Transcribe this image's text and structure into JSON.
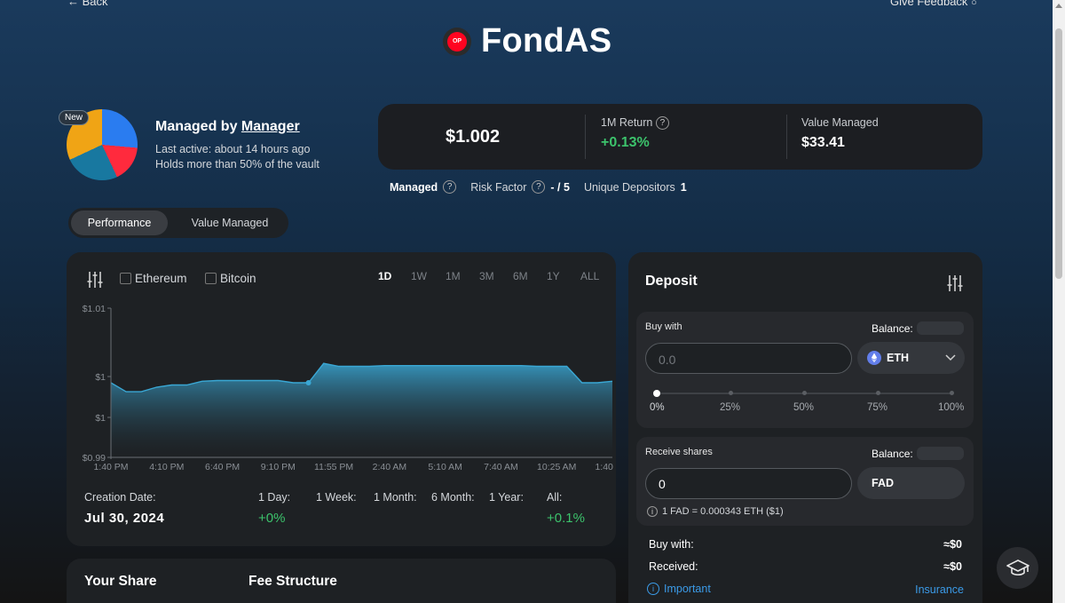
{
  "nav": {
    "back_label": "Back",
    "feedback_label": "Give Feedback"
  },
  "header": {
    "title": "FondAS",
    "badge_text": "OP"
  },
  "manager": {
    "new_badge": "New",
    "managed_by_prefix": "Managed by ",
    "manager_link": "Manager",
    "last_active": "Last active: about 14 hours ago",
    "holdings": "Holds more than 50% of the vault"
  },
  "stats": {
    "price": "$1.002",
    "return_label": "1M Return",
    "return_value": "+0.13%",
    "value_managed_label": "Value Managed",
    "value_managed": "$33.41"
  },
  "meta": {
    "managed_label": "Managed",
    "risk_label": "Risk Factor",
    "risk_value": "- / 5",
    "depositors_label": "Unique Depositors",
    "depositors_value": "1"
  },
  "tabs": [
    {
      "label": "Performance",
      "active": true
    },
    {
      "label": "Value Managed",
      "active": false
    }
  ],
  "chart_panel": {
    "compare": [
      "Ethereum",
      "Bitcoin"
    ],
    "ranges": [
      "1D",
      "1W",
      "1M",
      "3M",
      "6M",
      "1Y",
      "ALL"
    ],
    "active_range": "1D"
  },
  "chart_data": {
    "type": "area",
    "title": "",
    "xlabel": "",
    "ylabel": "",
    "y_tick_labels": [
      "$1.01",
      "$1",
      "$1",
      "$0.99"
    ],
    "x_tick_labels": [
      "1:40 PM",
      "4:10 PM",
      "6:40 PM",
      "9:10 PM",
      "11:55 PM",
      "2:40 AM",
      "5:10 AM",
      "7:40 AM",
      "10:25 AM",
      "1:40 PM"
    ],
    "ylim": [
      0.99,
      1.01
    ],
    "series": [
      {
        "values": [
          1.0,
          0.9988,
          0.9988,
          0.9994,
          0.9997,
          0.9997,
          1.0002,
          1.0003,
          1.0003,
          1.0003,
          1.0003,
          1.0003,
          1.0,
          1.0,
          1.0026,
          1.0022,
          1.0022,
          1.0022,
          1.0023,
          1.0023,
          1.0023,
          1.0023,
          1.0023,
          1.0023,
          1.0023,
          1.0023,
          1.0023,
          1.0023,
          1.0022,
          1.0022,
          1.0022,
          1.0,
          1.0,
          1.0002
        ]
      }
    ],
    "color": "#3aa7d4"
  },
  "returns": {
    "creation_label": "Creation Date:",
    "creation_value": "Jul 30, 2024",
    "day_label": "1 Day:",
    "day_value": "+0%",
    "week_label": "1 Week:",
    "month_label": "1 Month:",
    "six_month_label": "6 Month:",
    "year_label": "1 Year:",
    "all_label": "All:",
    "all_value": "+0.1%"
  },
  "bottom": {
    "your_share": "Your Share",
    "fee_structure": "Fee Structure"
  },
  "deposit": {
    "title": "Deposit",
    "buy_with_label": "Buy with",
    "balance_label": "Balance:",
    "amount_placeholder": "0.0",
    "token": "ETH",
    "slider_percent": 0,
    "slider_marks": [
      "0%",
      "25%",
      "50%",
      "75%",
      "100%"
    ],
    "receive_label": "Receive shares",
    "receive_value": "0",
    "share_token": "FAD",
    "rate": "1 FAD = 0.000343 ETH ($1)",
    "summary_buy_label": "Buy with:",
    "summary_buy_value": "≈$0",
    "summary_received_label": "Received:",
    "summary_received_value": "≈$0",
    "important_label": "Important",
    "insurance_label": "Insurance"
  }
}
